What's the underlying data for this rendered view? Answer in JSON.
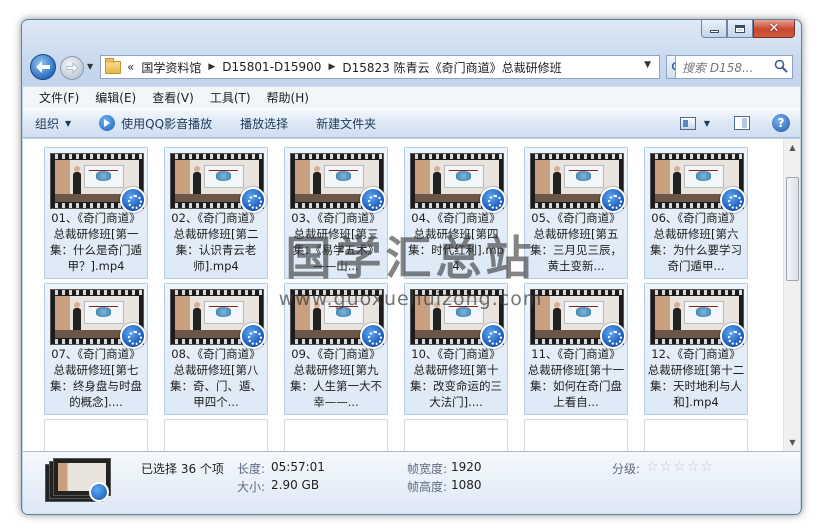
{
  "window": {
    "caption": {
      "min_icon": "minimize-icon",
      "max_icon": "maximize-icon",
      "close_icon": "close-icon"
    }
  },
  "address_bar": {
    "overflow": "«",
    "crumbs": [
      "国学资料馆",
      "D15801-D15900",
      "D15823 陈青云《奇门商道》总裁研修班"
    ],
    "search_placeholder": "搜索 D158..."
  },
  "menu": [
    "文件(F)",
    "编辑(E)",
    "查看(V)",
    "工具(T)",
    "帮助(H)"
  ],
  "commands": {
    "organize": "组织",
    "play_qq": "使用QQ影音播放",
    "play_select": "播放选择",
    "new_folder": "新建文件夹"
  },
  "files": [
    "01、《奇门商道》总裁研修班[第一集：什么是奇门遁甲？].mp4",
    "02、《奇门商道》总裁研修班[第二集：认识青云老师].mp4",
    "03、《奇门商道》总裁研修班[第三集：《易学五术》——山...",
    "04、《奇门商道》总裁研修班[第四集：时代红利].mp4",
    "05、《奇门商道》总裁研修班[第五集：三月见三辰，黄土变新...",
    "06、《奇门商道》总裁研修班[第六集：为什么要学习奇门遁甲...",
    "07、《奇门商道》总裁研修班[第七集：终身盘与时盘的概念]....",
    "08、《奇门商道》总裁研修班[第八集：奇、门、遁、甲四个...",
    "09、《奇门商道》总裁研修班[第九集：人生第一大不幸——...",
    "10、《奇门商道》总裁研修班[第十集：改变命运的三大法门]....",
    "11、《奇门商道》总裁研修班[第十一集：如何在奇门盘上看自...",
    "12、《奇门商道》总裁研修班[第十二集：天时地利与人和].mp4"
  ],
  "details": {
    "selected": "已选择 36 个项",
    "length_label": "长度:",
    "length_value": "05:57:01",
    "size_label": "大小:",
    "size_value": "2.90 GB",
    "frame_width_label": "帧宽度:",
    "frame_width_value": "1920",
    "frame_height_label": "帧高度:",
    "frame_height_value": "1080",
    "rating_label": "分级:",
    "rating_value": 0,
    "rating_max": 5
  },
  "watermark": {
    "title": "国学汇总站",
    "url": "www.guoxuehuizong.com"
  },
  "colors": {
    "accent": "#2d6fc0",
    "close_button": "#c7462e",
    "tile_selected": "#dde9f6"
  }
}
